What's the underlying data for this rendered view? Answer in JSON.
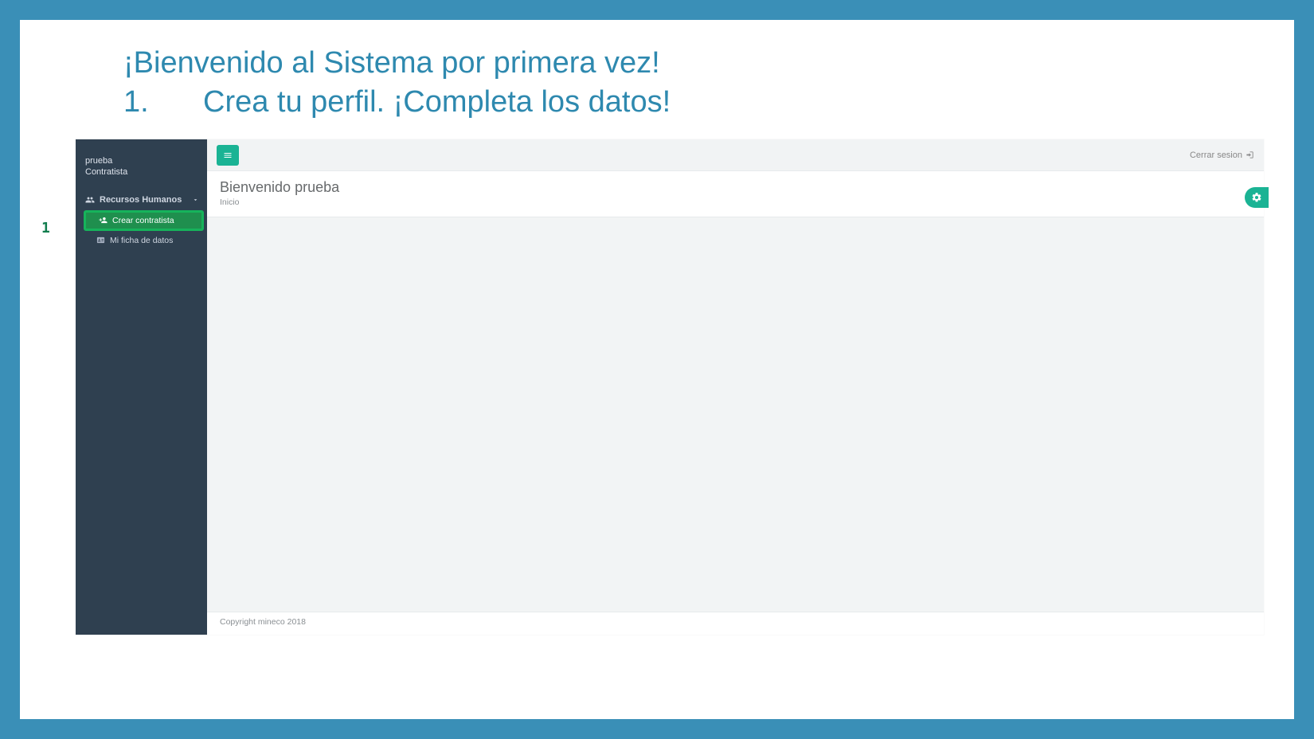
{
  "slide": {
    "title_line1": "¡Bienvenido al Sistema por primera vez!",
    "step_number": "1.",
    "step_text": "Crea tu perfil. ¡Completa los datos!",
    "callout_marker": "1"
  },
  "sidebar": {
    "user_name": "prueba",
    "user_role": "Contratista",
    "menu_parent_label": "Recursos Humanos",
    "items": [
      {
        "label": "Crear contratista",
        "icon": "user-plus-icon",
        "highlighted": true
      },
      {
        "label": "Mi ficha de datos",
        "icon": "id-card-icon",
        "highlighted": false
      }
    ]
  },
  "topbar": {
    "logout_label": "Cerrar sesion"
  },
  "page": {
    "welcome_title": "Bienvenido prueba",
    "breadcrumb": "Inicio"
  },
  "footer": {
    "copyright": "Copyright mineco 2018"
  }
}
